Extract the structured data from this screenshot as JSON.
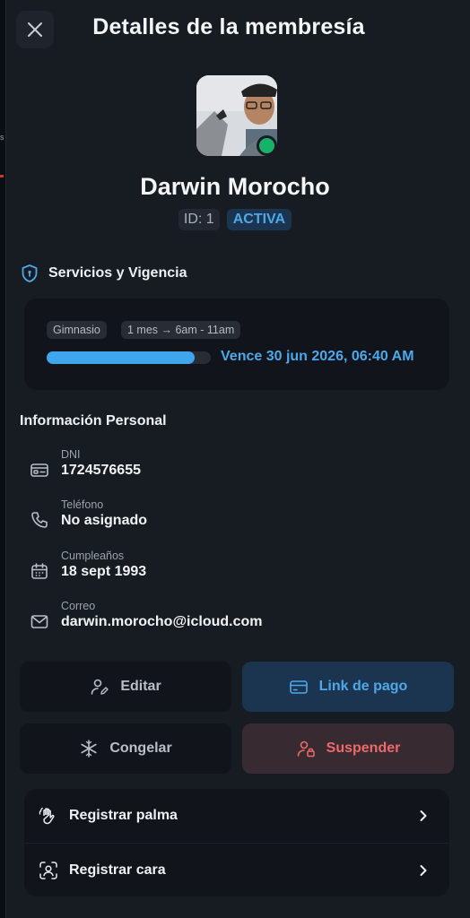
{
  "header": {
    "title": "Detalles de la membresía"
  },
  "member": {
    "name": "Darwin Morocho",
    "id_label": "ID: 1",
    "status": "ACTIVA",
    "online": true
  },
  "services": {
    "title": "Servicios y Vigencia",
    "plan": "Gimnasio",
    "schedule": "1 mes → 6am - 11am",
    "progress": 0.9,
    "expires": "Vence 30 jun 2026, 06:40 AM"
  },
  "personal": {
    "title": "Información Personal",
    "fields": [
      {
        "label": "DNI",
        "value": "1724576655",
        "icon": "id-card-icon"
      },
      {
        "label": "Teléfono",
        "value": "No asignado",
        "icon": "phone-icon"
      },
      {
        "label": "Cumpleaños",
        "value": "18 sept 1993",
        "icon": "calendar-icon"
      },
      {
        "label": "Correo",
        "value": "darwin.morocho@icloud.com",
        "icon": "mail-icon"
      }
    ]
  },
  "actions": {
    "edit": "Editar",
    "payment_link": "Link de pago",
    "freeze": "Congelar",
    "suspend": "Suspender"
  },
  "biometrics": {
    "palm": "Registrar palma",
    "face": "Registrar cara"
  },
  "colors": {
    "accent": "#4ea8e8",
    "danger": "#ee6a6a",
    "online": "#16b26a"
  }
}
